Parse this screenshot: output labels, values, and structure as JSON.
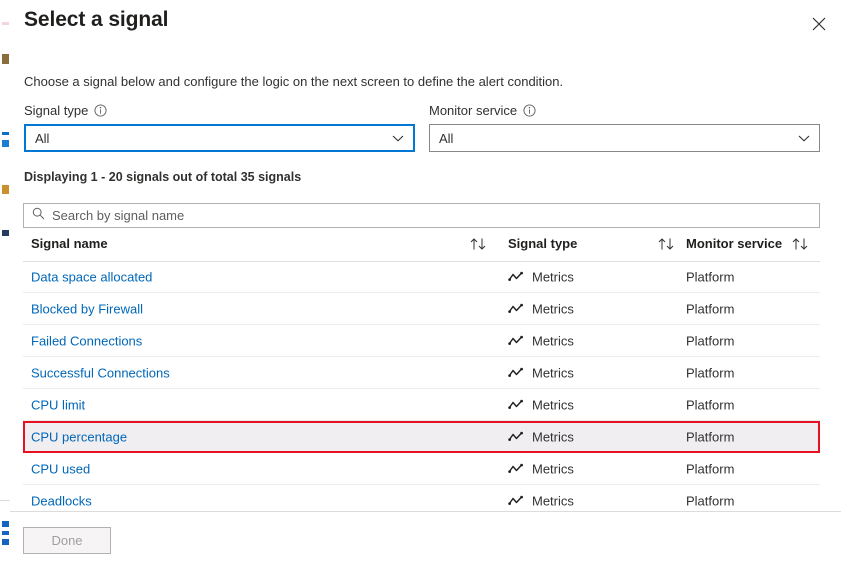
{
  "blade": {
    "title": "Select a signal",
    "close_label": "Close",
    "close_icon": "close-icon",
    "subtitle": "Choose a signal below and configure the logic on the next screen to define the alert condition."
  },
  "filters": [
    {
      "label": "Signal type",
      "info_icon": "info-icon",
      "value": "All",
      "focused": true
    },
    {
      "label": "Monitor service",
      "info_icon": "info-icon",
      "value": "All",
      "focused": false
    }
  ],
  "count_text": "Displaying 1 - 20 signals out of total 35 signals",
  "search": {
    "icon": "search-icon",
    "placeholder": "Search by signal name",
    "value": ""
  },
  "table": {
    "columns": [
      {
        "label": "Signal name",
        "sort_icon": "sort-updown-icon"
      },
      {
        "label": "Signal type",
        "sort_icon": "sort-updown-icon"
      },
      {
        "label": "Monitor service",
        "sort_icon": "sort-updown-icon"
      }
    ],
    "rows": [
      {
        "name": "Data space allocated",
        "type_icon": "metrics-icon",
        "type": "Metrics",
        "service": "Platform",
        "selected": false
      },
      {
        "name": "Blocked by Firewall",
        "type_icon": "metrics-icon",
        "type": "Metrics",
        "service": "Platform",
        "selected": false
      },
      {
        "name": "Failed Connections",
        "type_icon": "metrics-icon",
        "type": "Metrics",
        "service": "Platform",
        "selected": false
      },
      {
        "name": "Successful Connections",
        "type_icon": "metrics-icon",
        "type": "Metrics",
        "service": "Platform",
        "selected": false
      },
      {
        "name": "CPU limit",
        "type_icon": "metrics-icon",
        "type": "Metrics",
        "service": "Platform",
        "selected": false
      },
      {
        "name": "CPU percentage",
        "type_icon": "metrics-icon",
        "type": "Metrics",
        "service": "Platform",
        "selected": true
      },
      {
        "name": "CPU used",
        "type_icon": "metrics-icon",
        "type": "Metrics",
        "service": "Platform",
        "selected": false
      },
      {
        "name": "Deadlocks",
        "type_icon": "metrics-icon",
        "type": "Metrics",
        "service": "Platform",
        "selected": false
      }
    ]
  },
  "footer": {
    "done_label": "Done"
  },
  "colors": {
    "link": "#0067b8",
    "focus_border": "#0078d4",
    "selection_border": "#e81123",
    "selection_background": "#f1eef1",
    "text": "#323130"
  }
}
